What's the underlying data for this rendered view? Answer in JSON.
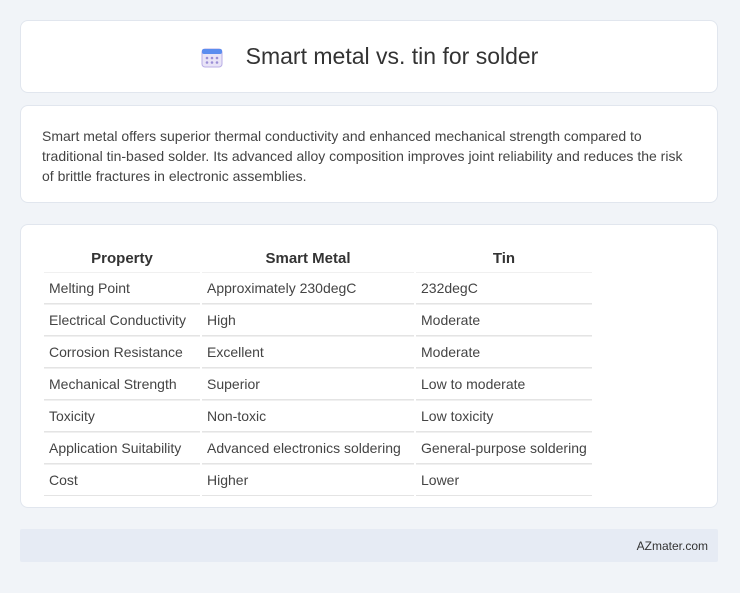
{
  "header": {
    "title": "Smart metal vs. tin for solder",
    "icon": "calendar-icon"
  },
  "description": "Smart metal offers superior thermal conductivity and enhanced mechanical strength compared to traditional tin-based solder. Its advanced alloy composition improves joint reliability and reduces the risk of brittle fractures in electronic assemblies.",
  "table": {
    "headers": [
      "Property",
      "Smart Metal",
      "Tin"
    ],
    "rows": [
      [
        "Melting Point",
        "Approximately 230degC",
        "232degC"
      ],
      [
        "Electrical Conductivity",
        "High",
        "Moderate"
      ],
      [
        "Corrosion Resistance",
        "Excellent",
        "Moderate"
      ],
      [
        "Mechanical Strength",
        "Superior",
        "Low to moderate"
      ],
      [
        "Toxicity",
        "Non-toxic",
        "Low toxicity"
      ],
      [
        "Application Suitability",
        "Advanced electronics soldering",
        "General-purpose soldering"
      ],
      [
        "Cost",
        "Higher",
        "Lower"
      ]
    ]
  },
  "footer": {
    "brand": "AZmater.com"
  }
}
